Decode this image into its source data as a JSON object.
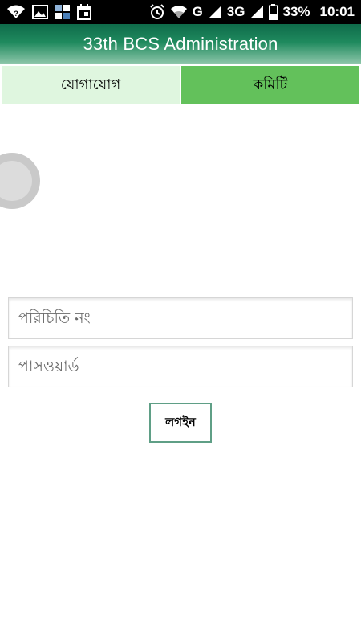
{
  "status_bar": {
    "icons": [
      "wifi-question-icon",
      "image-icon",
      "app-icon",
      "calendar-icon",
      "alarm-icon",
      "wifi-icon",
      "signal-icon",
      "signal-icon",
      "battery-icon"
    ],
    "network_g": "G",
    "network_3g": "3G",
    "battery": "33%",
    "time": "10:01"
  },
  "app_bar": {
    "title": "33th BCS Administration",
    "colors": {
      "top": "#0f6b4a",
      "bottom": "#8fc7ab"
    }
  },
  "tabs": [
    {
      "label": "যোগাযোগ",
      "color": "#dff6df"
    },
    {
      "label": "কমিটি",
      "color": "#63c15b"
    }
  ],
  "form": {
    "id_placeholder": "পরিচিতি নং",
    "id_value": "",
    "password_placeholder": "পাসওয়ার্ড",
    "password_value": "",
    "login_label": "লগইন"
  }
}
